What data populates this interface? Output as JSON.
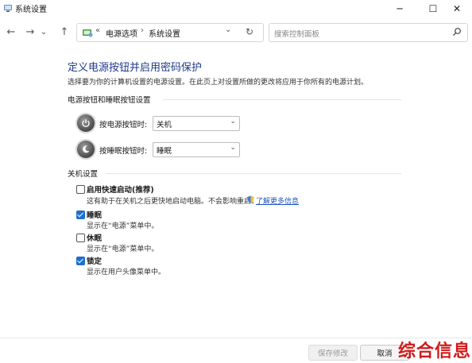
{
  "window": {
    "title": "系统设置",
    "controls": {
      "minimize": "─",
      "maximize": "☐",
      "close": "✕"
    }
  },
  "nav": {
    "back_icon": "←",
    "forward_icon": "→",
    "history_icon": "⌄",
    "up_icon": "↑",
    "breadcrumb": {
      "prefix": "«",
      "items": [
        "电源选项",
        "系统设置"
      ],
      "separator": "›"
    },
    "dropdown_icon": "⌄",
    "refresh_icon": "↻",
    "search": {
      "placeholder": "搜索控制面板"
    }
  },
  "page": {
    "heading": "定义电源按钮并启用密码保护",
    "description": "选择要为你的计算机设置的电源设置。在此页上对设置所做的更改将应用于你所有的电源计划。",
    "power_section": {
      "title": "电源按钮和睡眠按钮设置",
      "rows": [
        {
          "label": "按电源按钮时:",
          "value": "关机"
        },
        {
          "label": "按睡眠按钮时:",
          "value": "睡眠"
        }
      ]
    },
    "shutdown_section": {
      "title": "关机设置",
      "options": [
        {
          "title": "启用快速启动(推荐)",
          "desc": "这有助于在关机之后更快地启动电脑。不会影响重启。",
          "link": "了解更多信息",
          "checked": false
        },
        {
          "title": "睡眠",
          "desc": "显示在“电源”菜单中。",
          "checked": true
        },
        {
          "title": "休眠",
          "desc": "显示在“电源”菜单中。",
          "checked": false
        },
        {
          "title": "锁定",
          "desc": "显示在用户头像菜单中。",
          "checked": true
        }
      ]
    }
  },
  "footer": {
    "save_label": "保存修改",
    "cancel_label": "取消"
  },
  "watermark": "综合信息",
  "colors": {
    "heading": "#1e3a8a",
    "checkbox_on": "#1f6fd1",
    "link": "#1f57c3",
    "watermark": "#d11b1b"
  }
}
